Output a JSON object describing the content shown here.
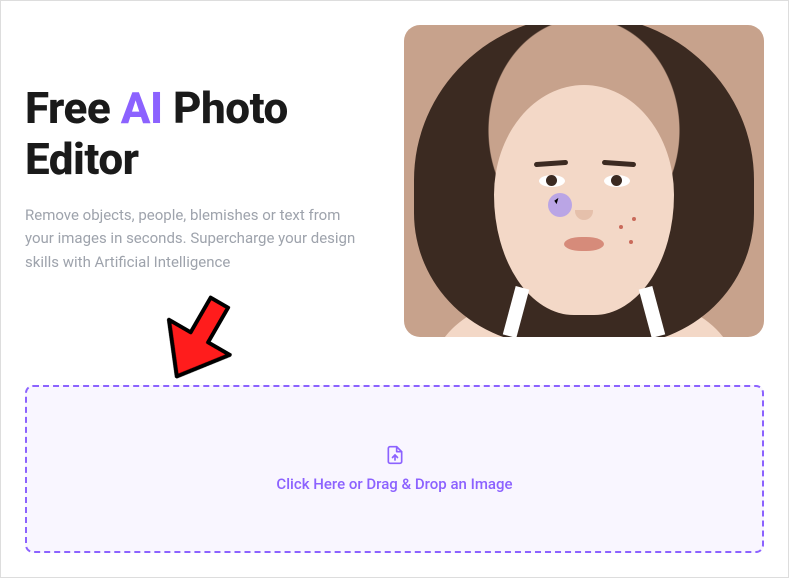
{
  "hero": {
    "headline_pre": "Free ",
    "headline_ai": "AI",
    "headline_post": " Photo Editor",
    "subhead": "Remove objects, people, blemishes or text from your images in seconds. Supercharge your design skills with Artificial Intelligence"
  },
  "dropzone": {
    "label": "Click Here or Drag & Drop an Image"
  },
  "colors": {
    "accent": "#8c62ff",
    "dropzone_bg": "#f9f6ff",
    "overlay_arrow": "#ff0000"
  }
}
